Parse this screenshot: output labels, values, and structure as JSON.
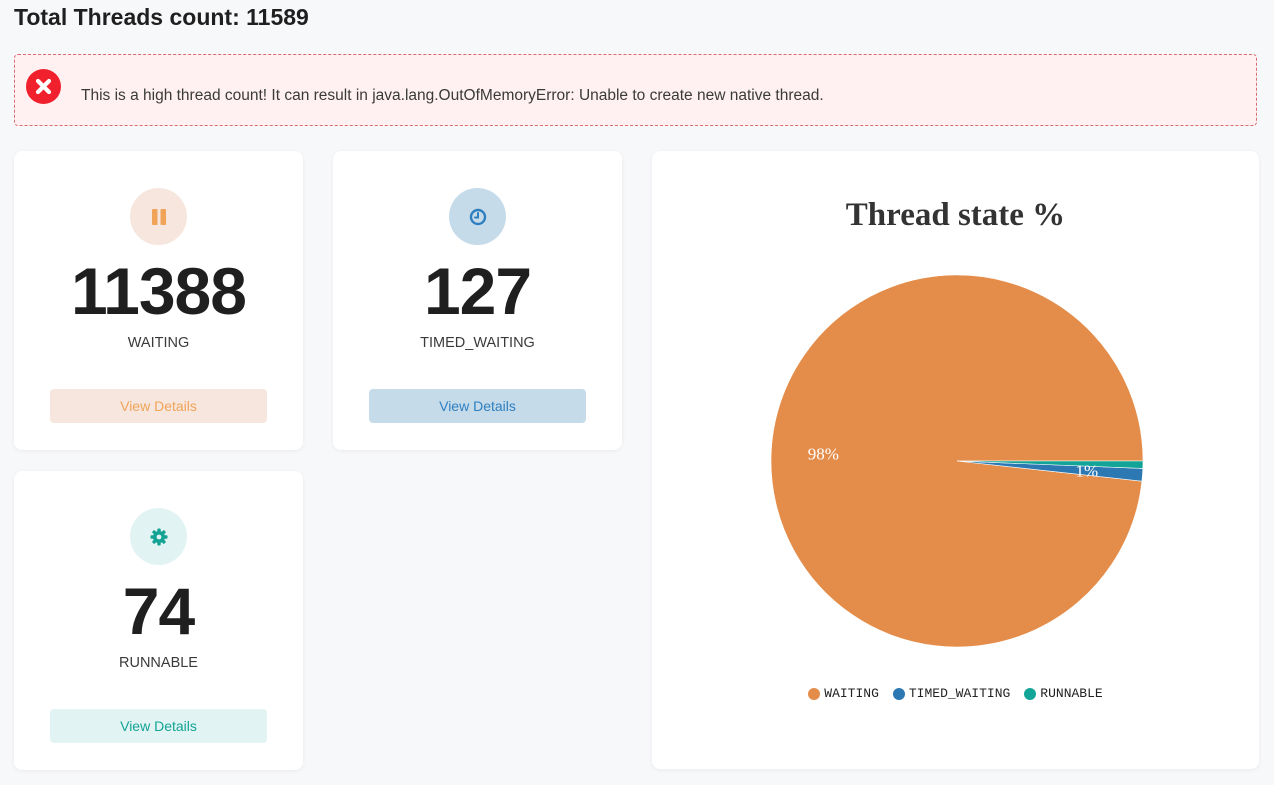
{
  "page": {
    "title": "Total Threads count: 11589"
  },
  "alert": {
    "message": "This is a high thread count! It can result in java.lang.OutOfMemoryError: Unable to create new native thread."
  },
  "cards": [
    {
      "state": "WAITING",
      "count": "11388",
      "button_label": "View Details",
      "icon": "pause-icon",
      "accent": "#f0a45a",
      "tint": "#f7e6dd"
    },
    {
      "state": "TIMED_WAITING",
      "count": "127",
      "button_label": "View Details",
      "icon": "clock-icon",
      "accent": "#2f7fbf",
      "tint": "#c5dbea"
    },
    {
      "state": "RUNNABLE",
      "count": "74",
      "button_label": "View Details",
      "icon": "gear-icon",
      "accent": "#13a394",
      "tint": "#e2f3f3"
    }
  ],
  "chart_data": {
    "type": "pie",
    "title": "Thread state %",
    "categories": [
      "WAITING",
      "TIMED_WAITING",
      "RUNNABLE"
    ],
    "values": [
      11388,
      127,
      74
    ],
    "colors": [
      "#e48d4b",
      "#2b78b3",
      "#12a597"
    ],
    "slice_labels": [
      "98%",
      "1%",
      ""
    ],
    "legend": "bottom"
  }
}
